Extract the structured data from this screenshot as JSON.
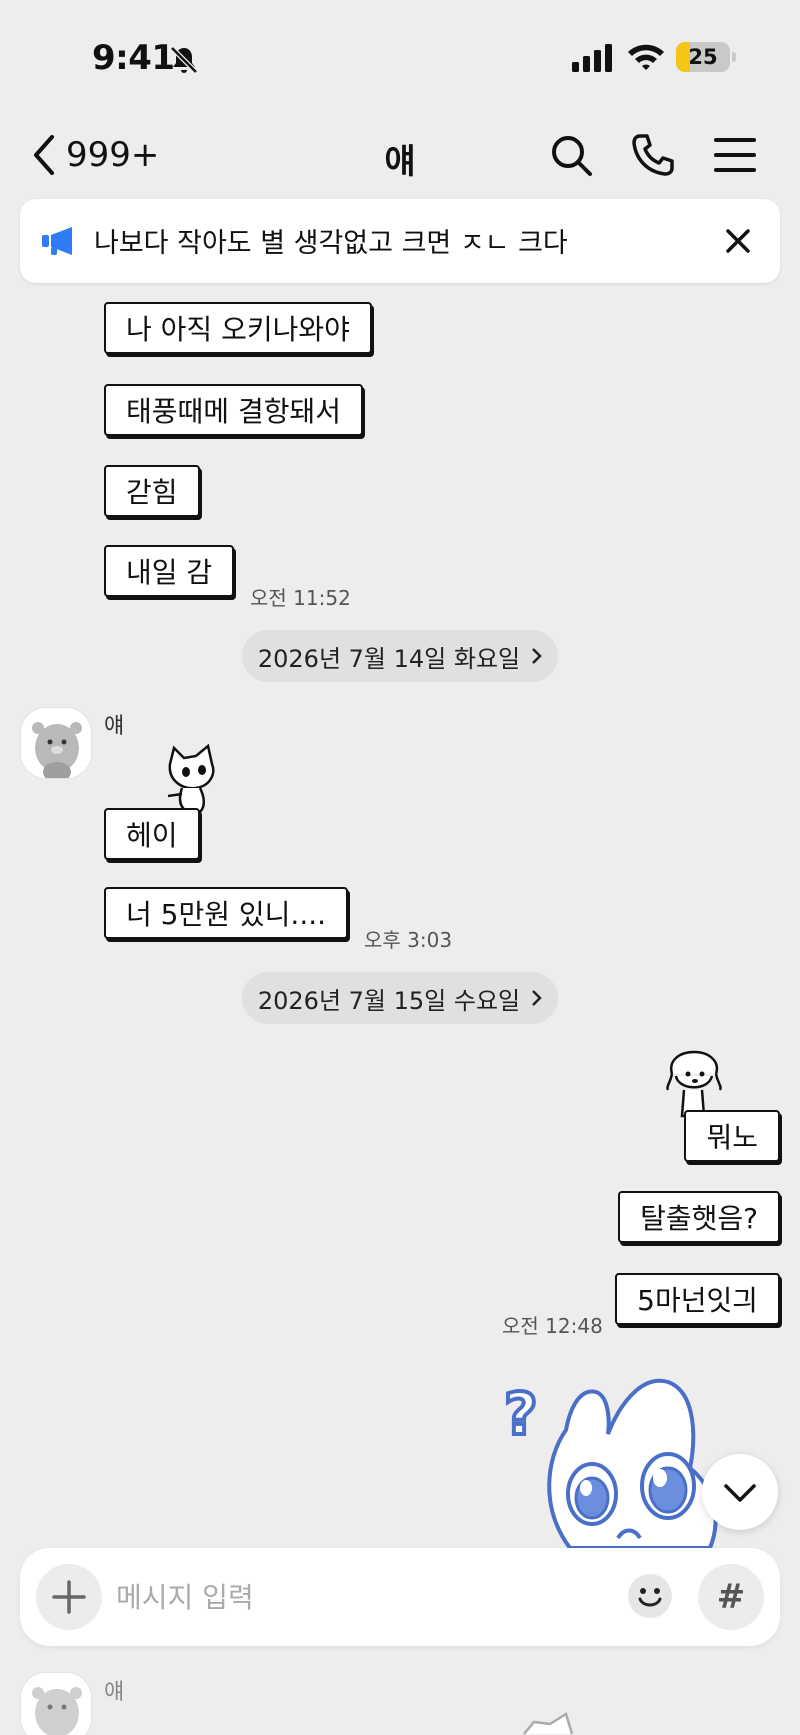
{
  "status_bar": {
    "time": "9:41",
    "battery": "25",
    "battery_level": 0.25
  },
  "header": {
    "back_count": "999+",
    "title": "얘"
  },
  "notice": {
    "text": "나보다 작아도 별 생각없고 크면 ㅈㄴ 크다"
  },
  "messages": {
    "m1": "나 아직 오키나와야",
    "m2": "태풍때메 결항돼서",
    "m3": "갇힘",
    "m4": "내일 감",
    "t1": "오전 11:52",
    "date1": "2026년 7월 14일 화요일",
    "sender1": "얘",
    "m5": "헤이",
    "m6": "너 5만원 있니....",
    "t2": "오후 3:03",
    "date2": "2026년 7월 15일 수요일",
    "m7": "뭐노",
    "m8": "탈출햇음?",
    "m9": "5마넌잇긔",
    "t3": "오전 12:48",
    "sender2": "얘"
  },
  "input": {
    "placeholder": "메시지 입력"
  },
  "colors": {
    "background": "#ededed",
    "accent": "#2f7cf6",
    "battery_fill": "#f5c518",
    "sticker_blue": "#4a6fc9"
  }
}
